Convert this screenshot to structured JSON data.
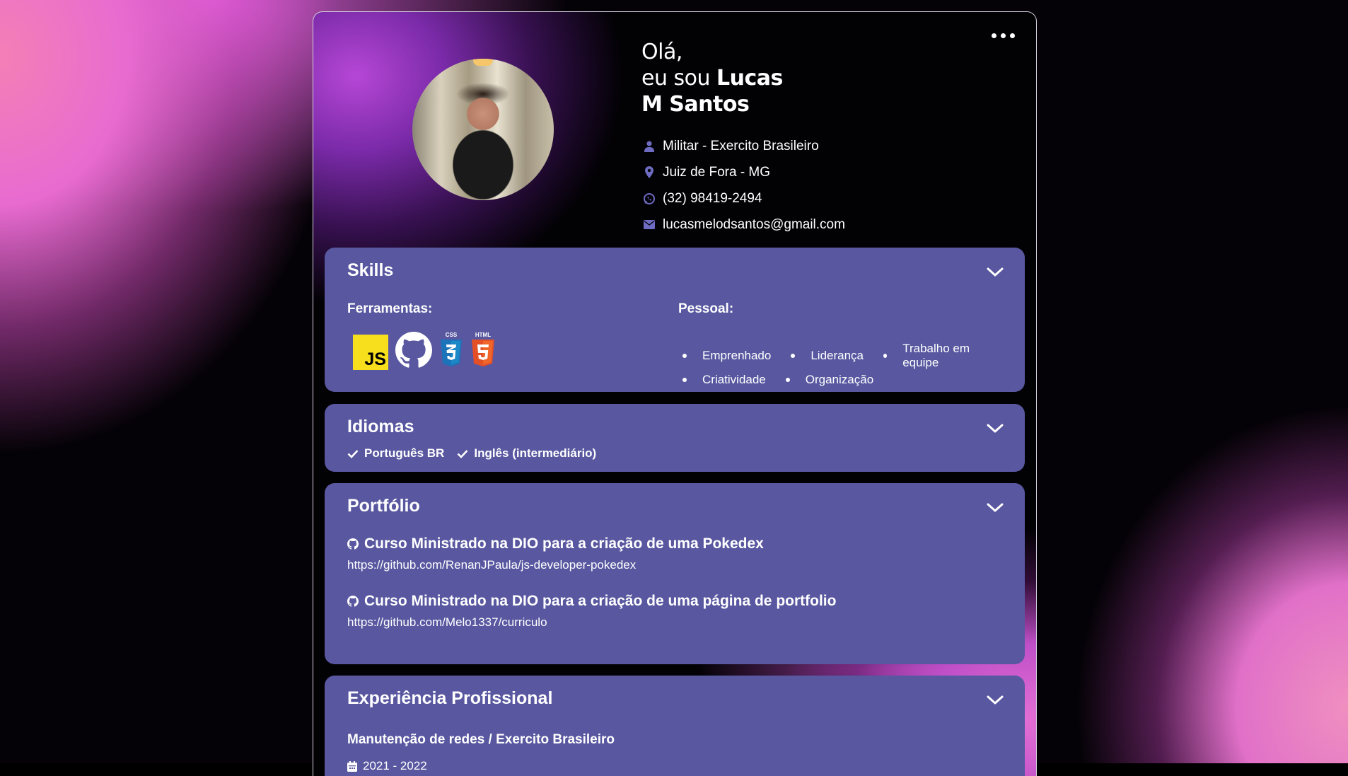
{
  "header": {
    "greeting_line1": "Olá,",
    "greeting_line2_prefix": "eu sou ",
    "greeting_line2_name": "Lucas",
    "greeting_line3": "M Santos",
    "info": [
      {
        "icon": "person-icon",
        "text": "Militar - Exercito Brasileiro"
      },
      {
        "icon": "location-pin-icon",
        "text": "Juiz de Fora - MG"
      },
      {
        "icon": "whatsapp-icon",
        "text": "(32) 98419-2494"
      },
      {
        "icon": "mail-icon",
        "text": "lucasmelodsantos@gmail.com"
      }
    ]
  },
  "skills": {
    "title": "Skills",
    "tools_label": "Ferramentas:",
    "tools": [
      {
        "icon": "javascript-icon",
        "text": "JS"
      },
      {
        "icon": "github-icon"
      },
      {
        "icon": "css3-icon",
        "text": "CSS"
      },
      {
        "icon": "html5-icon",
        "text": "HTML"
      }
    ],
    "personal_label": "Pessoal:",
    "personal": [
      "Emprenhado",
      "Liderança",
      "Trabalho em equipe",
      "Criatividade",
      "Organização"
    ]
  },
  "languages": {
    "title": "Idiomas",
    "items": [
      "Português BR",
      "Inglês (intermediário)"
    ]
  },
  "portfolio": {
    "title": "Portfólio",
    "projects": [
      {
        "title": "Curso Ministrado na DIO para a criação de uma Pokedex",
        "url": "https://github.com/RenanJPaula/js-developer-pokedex"
      },
      {
        "title": "Curso Ministrado na DIO para a criação de uma página de portfolio",
        "url": "https://github.com/Melo1337/curriculo"
      }
    ]
  },
  "experience": {
    "title": "Experiência Profissional",
    "role": "Manutenção de redes / Exercito Brasileiro",
    "period": "2021 - 2022"
  },
  "colors": {
    "section_bg": "#5857a0",
    "accent": "#5857a0"
  }
}
